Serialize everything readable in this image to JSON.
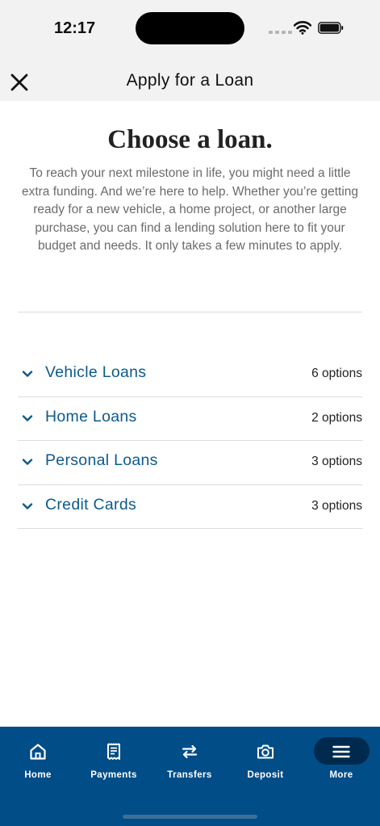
{
  "status": {
    "time": "12:17"
  },
  "nav": {
    "title": "Apply for a Loan",
    "close_icon": "close-icon"
  },
  "main": {
    "headline": "Choose a loan.",
    "intro": "To reach your next milestone in life, you might need a little extra funding. And we’re here to help. Whether you’re getting ready for a new vehicle, a home project, or another large purchase, you can find a lending solution here to fit your budget and needs. It only takes a few minutes to apply."
  },
  "loans": [
    {
      "name": "Vehicle Loans",
      "count": "6 options"
    },
    {
      "name": "Home Loans",
      "count": "2 options"
    },
    {
      "name": "Personal Loans",
      "count": "3 options"
    },
    {
      "name": "Credit Cards",
      "count": "3 options"
    }
  ],
  "tabs": [
    {
      "label": "Home",
      "icon": "home-icon"
    },
    {
      "label": "Payments",
      "icon": "receipt-icon"
    },
    {
      "label": "Transfers",
      "icon": "transfer-arrows-icon"
    },
    {
      "label": "Deposit",
      "icon": "camera-icon"
    },
    {
      "label": "More",
      "icon": "hamburger-menu-icon"
    }
  ],
  "colors": {
    "accent": "#0d5a8c",
    "tab_bar": "#004d88",
    "active_pill": "#002a4d",
    "divider": "#dcdcdc"
  }
}
